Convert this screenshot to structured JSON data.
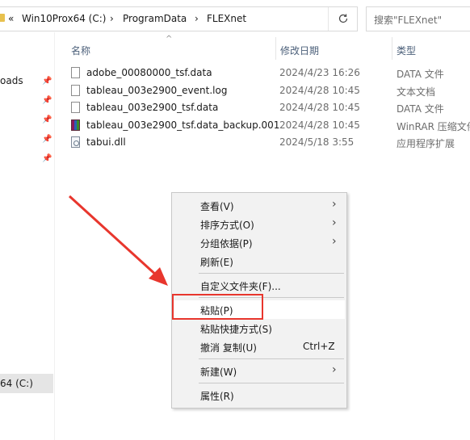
{
  "addressbar": {
    "crumb_prefix": "«",
    "crumbs": [
      "Win10Prox64 (C:)",
      "ProgramData",
      "FLEXnet"
    ],
    "separator": "›",
    "refresh_icon": "refresh-icon"
  },
  "search": {
    "placeholder": "搜索\"FLEXnet\""
  },
  "nav": {
    "items": [
      {
        "label": "oads"
      },
      {
        "label": "64 (C:)"
      }
    ]
  },
  "columns": {
    "name": "名称",
    "date": "修改日期",
    "type": "类型"
  },
  "files": [
    {
      "name": "adobe_00080000_tsf.data",
      "date": "2024/4/23 16:26",
      "type": "DATA 文件",
      "icon": "file-icon"
    },
    {
      "name": "tableau_003e2900_event.log",
      "date": "2024/4/28 10:45",
      "type": "文本文档",
      "icon": "file-icon"
    },
    {
      "name": "tableau_003e2900_tsf.data",
      "date": "2024/4/28 10:45",
      "type": "DATA 文件",
      "icon": "file-icon"
    },
    {
      "name": "tableau_003e2900_tsf.data_backup.001",
      "date": "2024/4/28 10:45",
      "type": "WinRAR 压缩文件",
      "icon": "winrar-icon"
    },
    {
      "name": "tabui.dll",
      "date": "2024/5/18 3:55",
      "type": "应用程序扩展",
      "icon": "dll-icon"
    }
  ],
  "context_menu": {
    "view": "查看(V)",
    "sort": "排序方式(O)",
    "group": "分组依据(P)",
    "refresh": "刷新(E)",
    "customize": "自定义文件夹(F)...",
    "paste": "粘贴(P)",
    "paste_shortcut": "粘贴快捷方式(S)",
    "undo": "撤消 复制(U)",
    "undo_shortcut": "Ctrl+Z",
    "new": "新建(W)",
    "properties": "属性(R)"
  },
  "colors": {
    "highlight_box": "#e8362d",
    "arrow": "#e8362d",
    "header_text": "#4c607a"
  }
}
